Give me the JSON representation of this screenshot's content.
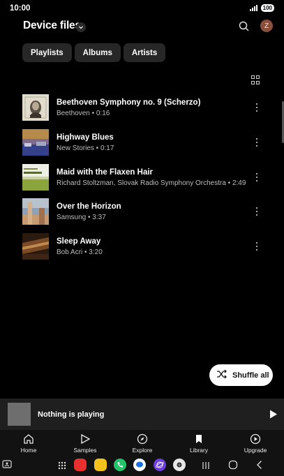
{
  "status_bar": {
    "time": "10:00",
    "battery": "100"
  },
  "header": {
    "title": "Device files",
    "avatar_initial": "Z"
  },
  "chips": [
    "Playlists",
    "Albums",
    "Artists"
  ],
  "tracks": [
    {
      "title": "Beethoven Symphony no. 9 (Scherzo)",
      "subtitle": "Beethoven • 0:16"
    },
    {
      "title": "Highway Blues",
      "subtitle": "New Stories • 0:17"
    },
    {
      "title": "Maid with the Flaxen Hair",
      "subtitle": "Richard Stoltzman, Slovak Radio Symphony Orchestra • 2:49"
    },
    {
      "title": "Over the Horizon",
      "subtitle": "Samsung • 3:37"
    },
    {
      "title": "Sleep Away",
      "subtitle": "Bob Acri • 3:20"
    }
  ],
  "shuffle_label": "Shuffle all",
  "mini_player": {
    "status": "Nothing is playing"
  },
  "bottom_nav": [
    {
      "label": "Home",
      "icon": "home-icon"
    },
    {
      "label": "Samples",
      "icon": "play-outline-icon"
    },
    {
      "label": "Explore",
      "icon": "compass-icon"
    },
    {
      "label": "Library",
      "icon": "bookmark-icon"
    },
    {
      "label": "Upgrade",
      "icon": "play-circle-icon"
    }
  ]
}
